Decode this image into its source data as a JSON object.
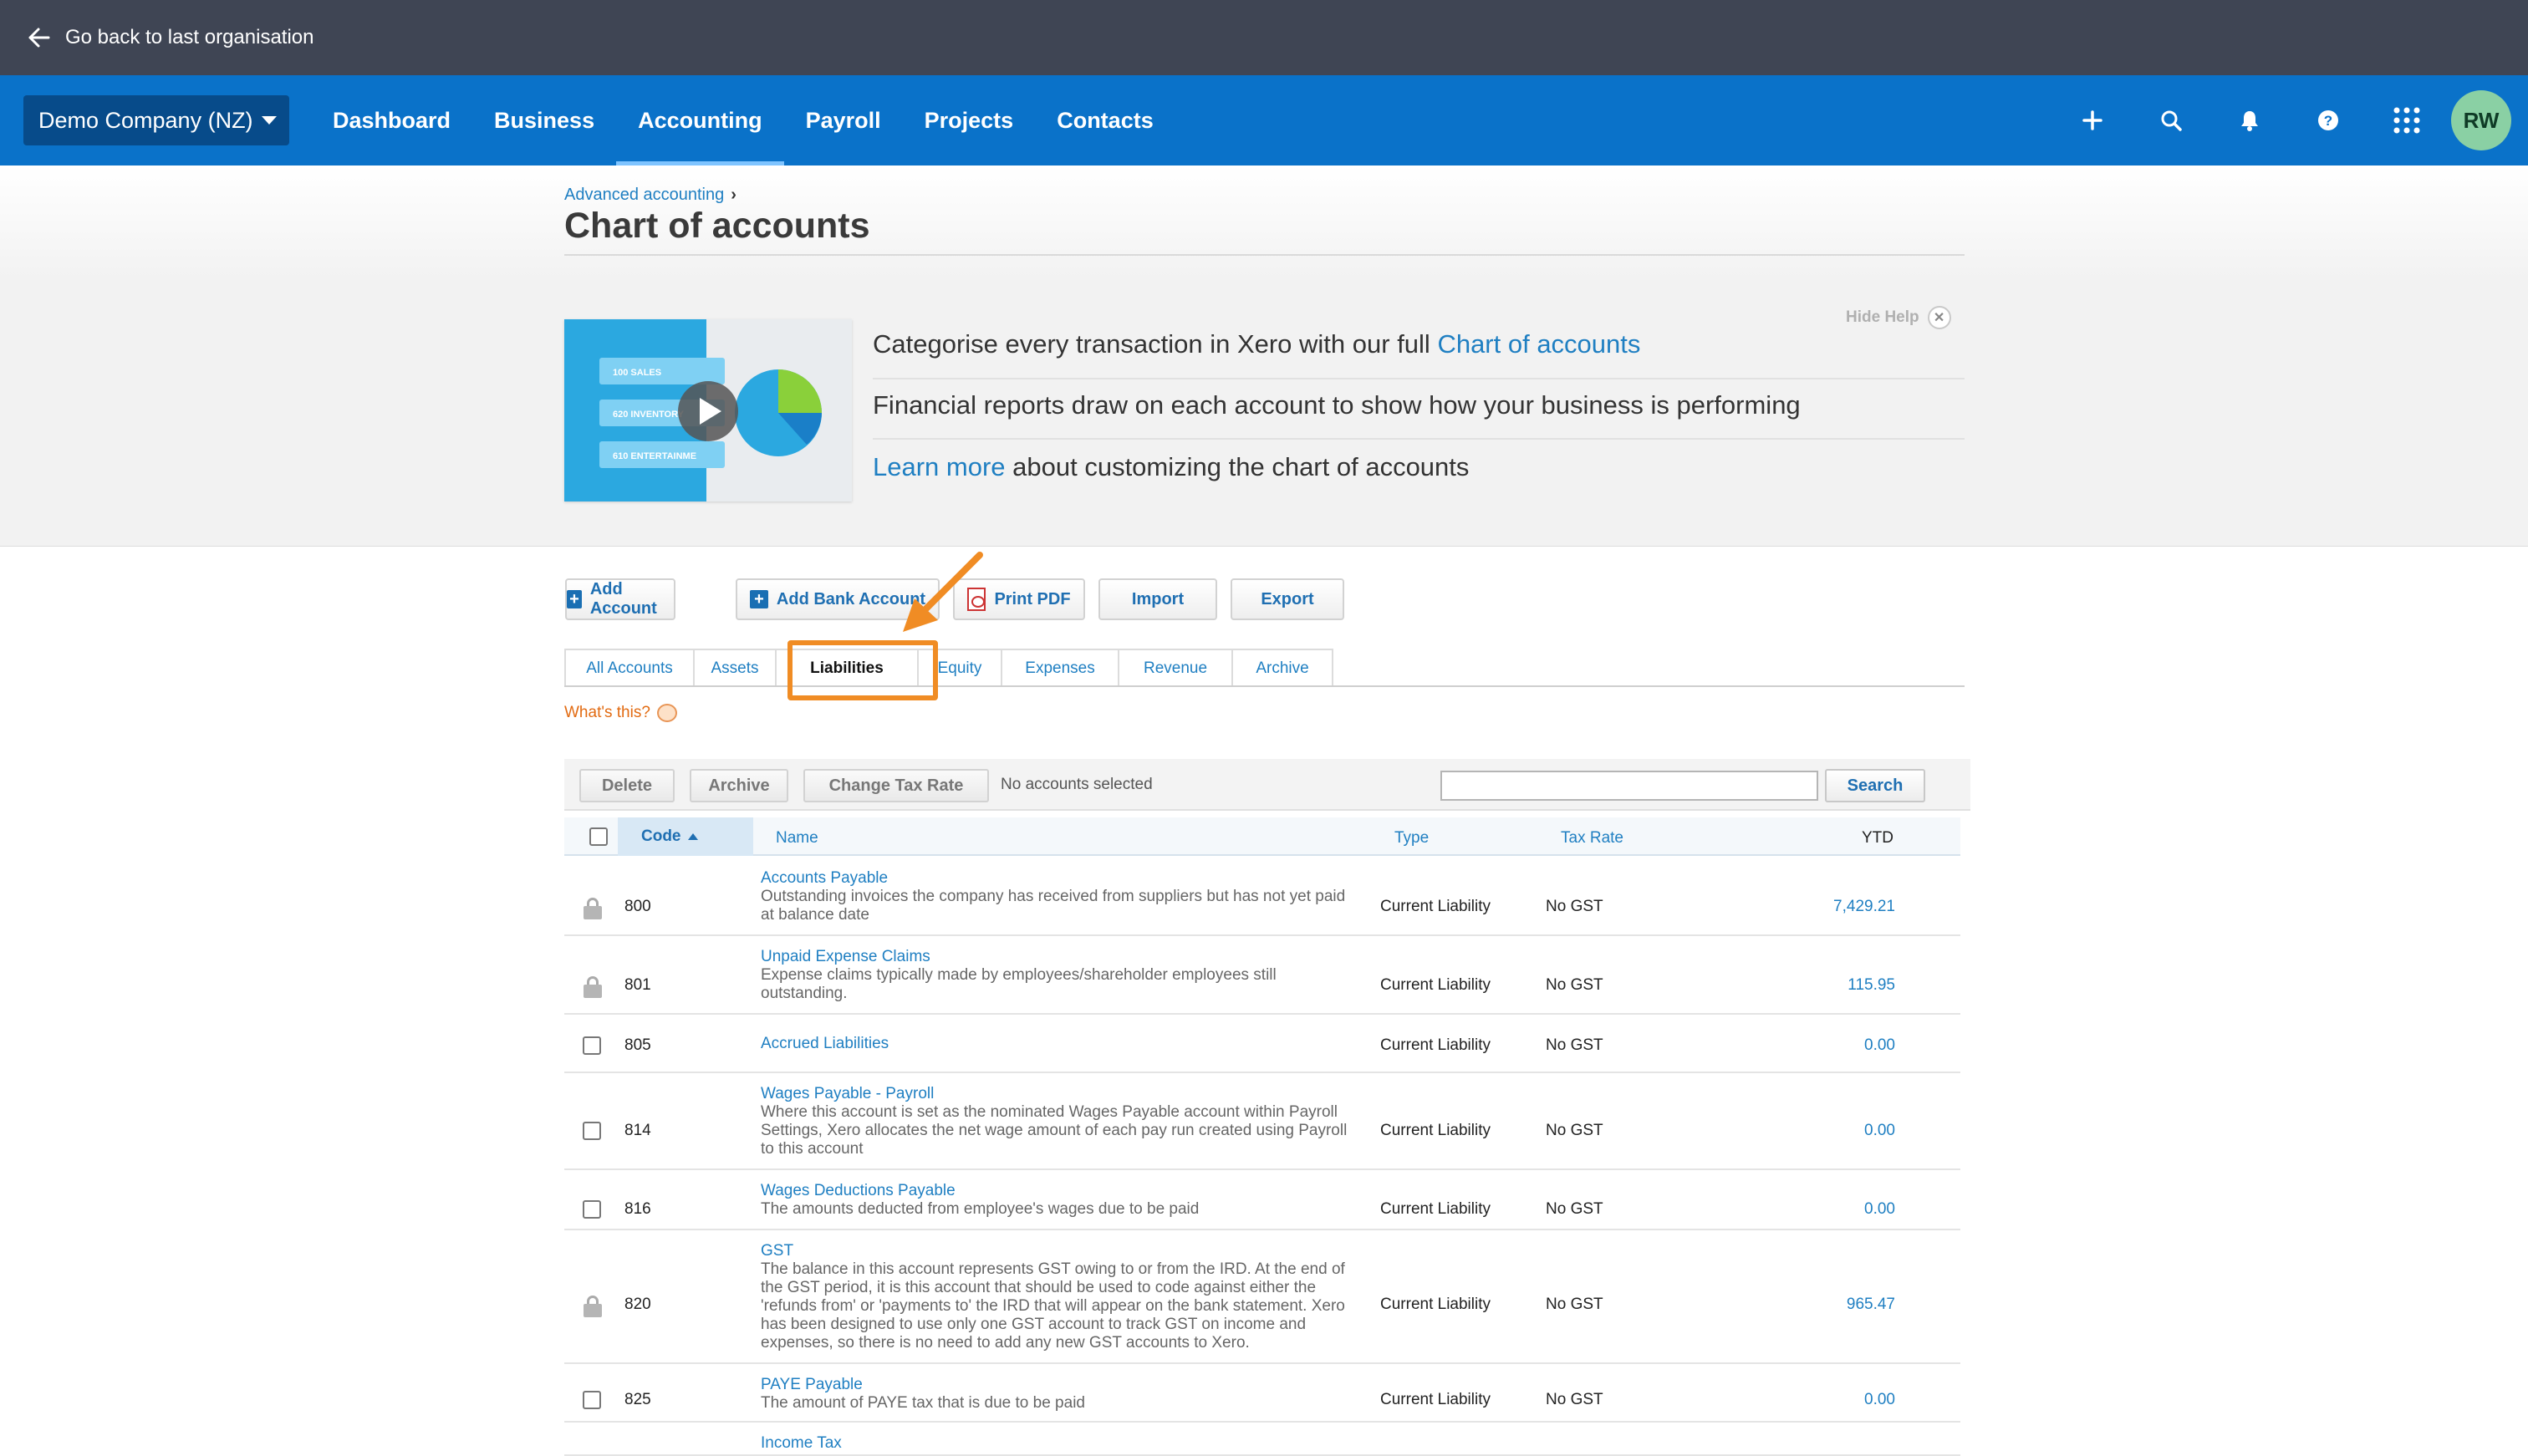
{
  "topbar": {
    "back_label": "Go back to last organisation"
  },
  "nav": {
    "org_name": "Demo Company (NZ)",
    "links": [
      "Dashboard",
      "Business",
      "Accounting",
      "Payroll",
      "Projects",
      "Contacts"
    ],
    "active": "Accounting",
    "avatar_initials": "RW",
    "icons": [
      "plus-icon",
      "search-icon",
      "bell-icon",
      "help-icon",
      "app-grid-icon"
    ]
  },
  "breadcrumb": {
    "parent": "Advanced accounting"
  },
  "page_title": "Chart of accounts",
  "help": {
    "hide_label": "Hide Help",
    "video_labels": [
      "100 SALES",
      "620 INVENTORY",
      "610 ENTERTAINME"
    ],
    "line1_text": "Categorise every transaction in Xero with our full ",
    "line1_link": "Chart of accounts",
    "line2_text": "Financial reports draw on each account to show how your business is performing",
    "line3_link": "Learn more",
    "line3_text": " about customizing the chart of accounts"
  },
  "toolbar": {
    "add_account": "Add Account",
    "add_bank_account": "Add Bank Account",
    "print_pdf": "Print PDF",
    "import": "Import",
    "export": "Export"
  },
  "tabs": [
    "All Accounts",
    "Assets",
    "Liabilities",
    "Equity",
    "Expenses",
    "Revenue",
    "Archive"
  ],
  "active_tab": "Liabilities",
  "whats_this": "What's this?",
  "actions": {
    "delete": "Delete",
    "archive": "Archive",
    "change_tax_rate": "Change Tax Rate",
    "no_selection": "No accounts selected",
    "search_value": "",
    "search_button": "Search"
  },
  "table": {
    "headers": {
      "code": "Code",
      "name": "Name",
      "type": "Type",
      "tax_rate": "Tax Rate",
      "ytd": "YTD"
    },
    "rows": [
      {
        "locked": true,
        "code": "800",
        "name": "Accounts Payable",
        "desc": "Outstanding invoices the company has received from suppliers but has not yet paid at balance date",
        "type": "Current Liability",
        "tax": "No GST",
        "ytd": "7,429.21"
      },
      {
        "locked": true,
        "code": "801",
        "name": "Unpaid Expense Claims",
        "desc": "Expense claims typically made by employees/shareholder employees still outstanding.",
        "type": "Current Liability",
        "tax": "No GST",
        "ytd": "115.95"
      },
      {
        "locked": false,
        "code": "805",
        "name": "Accrued Liabilities",
        "desc": "",
        "type": "Current Liability",
        "tax": "No GST",
        "ytd": "0.00"
      },
      {
        "locked": false,
        "code": "814",
        "name": "Wages Payable - Payroll",
        "desc": "Where this account is set as the nominated Wages Payable account within Payroll Settings, Xero allocates the net wage amount of each pay run created using Payroll to this account",
        "type": "Current Liability",
        "tax": "No GST",
        "ytd": "0.00"
      },
      {
        "locked": false,
        "code": "816",
        "name": "Wages Deductions Payable",
        "desc": "The amounts deducted from employee's wages due to be paid",
        "type": "Current Liability",
        "tax": "No GST",
        "ytd": "0.00"
      },
      {
        "locked": true,
        "code": "820",
        "name": "GST",
        "desc": "The balance in this account represents GST owing to or from the IRD. At the end of the GST period, it is this account that should be used to code against either the 'refunds from' or 'payments to' the IRD that will appear on the bank statement. Xero has been designed to use only one GST account to track GST on income and expenses, so there is no need to add any new GST accounts to Xero.",
        "type": "Current Liability",
        "tax": "No GST",
        "ytd": "965.47"
      },
      {
        "locked": false,
        "code": "825",
        "name": "PAYE Payable",
        "desc": "The amount of PAYE tax that is due to be paid",
        "type": "Current Liability",
        "tax": "No GST",
        "ytd": "0.00"
      },
      {
        "locked": false,
        "code": "",
        "name": "Income Tax",
        "desc": "",
        "type": "",
        "tax": "",
        "ytd": ""
      }
    ]
  },
  "colors": {
    "nav_blue": "#0a72c9",
    "topbar": "#3f4554",
    "link": "#1f7fc2",
    "highlight": "#f08c24"
  }
}
